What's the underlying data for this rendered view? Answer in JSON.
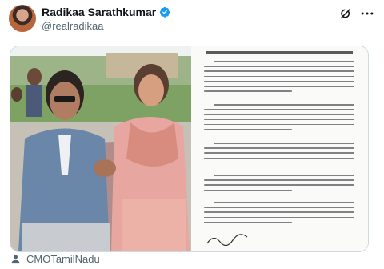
{
  "post": {
    "display_name": "Radikaa Sarathkumar",
    "handle": "@realradikaa"
  },
  "icons": {
    "verified": "verified-badge-icon",
    "grok": "grok-icon",
    "more": "more-options-icon",
    "person": "person-icon"
  },
  "colors": {
    "verified_blue": "#1d9bf0",
    "secondary_text": "#536471"
  },
  "footer": {
    "tagged": "CMOTamilNadu"
  }
}
